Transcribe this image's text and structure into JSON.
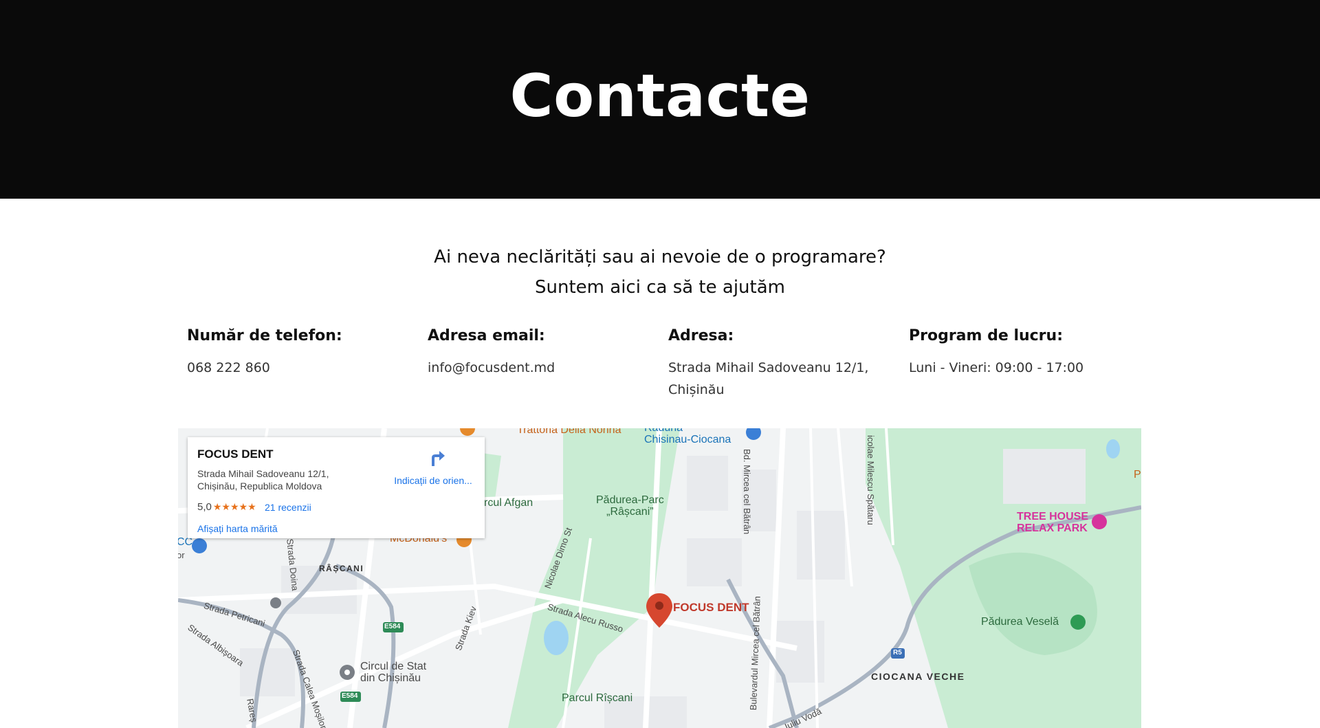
{
  "hero": {
    "title": "Contacte"
  },
  "intro": {
    "line1": "Ai neva neclărități sau ai nevoie de o programare?",
    "line2": "Suntem aici ca să te ajutăm"
  },
  "contact": {
    "phone": {
      "label": "Număr de telefon:",
      "value": "068 222 860"
    },
    "email": {
      "label": "Adresa email:",
      "value": "info@focusdent.md"
    },
    "address": {
      "label": "Adresa:",
      "line1": "Strada Mihail Sadoveanu 12/1,",
      "line2": "Chișinău"
    },
    "hours": {
      "label": "Program de lucru:",
      "value": "Luni - Vineri: 09:00 - 17:00"
    }
  },
  "map_card": {
    "name": "FOCUS DENT",
    "address_line1": "Strada Mihail Sadoveanu 12/1,",
    "address_line2": "Chișinău, Republica Moldova",
    "rating": "5,0",
    "stars": "★★★★★",
    "reviews": "21 recenzii",
    "directions": "Indicații de orien...",
    "larger_map": "Afișați harta mărită"
  },
  "map_labels": {
    "trattoria": "Trattoria Della Nonna",
    "raduna1": "Raduna",
    "raduna2": "Chisinau-Ciocana",
    "circul_afgan": "rcul Afgan",
    "padurea_parc1": "Pădurea-Parc",
    "padurea_parc2": "„Râșcani”",
    "mircea": "Bd. Mircea cel Bătrân",
    "milescu": "icolae Milescu Spătaru",
    "treehouse1": "TREE HOUSE",
    "treehouse2": "RELAX PARK",
    "edge_p": "P",
    "edge_cc": "CC",
    "edge_or": "or",
    "mcdonalds": "McDonald's",
    "rascani": "RÂȘCANI",
    "dimo": "Nicolae Dimo St",
    "doina": "Strada Doina",
    "petricani": "Strada Petricani",
    "albisoara": "Strada Albișoara",
    "kiev": "Strada Kiev",
    "alecu": "Strada Alecu Russo",
    "focus": "FOCUS DENT",
    "bulevardul": "Bulevardul Mircea cel Bătrân",
    "padurea_vesela": "Pădurea Veselă",
    "circul1": "Circul de Stat",
    "circul2": "din Chișinău",
    "parcul": "Parcul Rîșcani",
    "ciocana": "CIOCANA VECHE",
    "voda": "Iuliu Vodă",
    "rares": "Rareș",
    "calea": "Strada Calea Moșilor",
    "e584": "E584",
    "r5": "R5"
  },
  "colors": {
    "hero_bg": "#0a0a0a",
    "park": "#c9ecd3",
    "road": "#a9b4c2",
    "pin": "#d6472f"
  }
}
